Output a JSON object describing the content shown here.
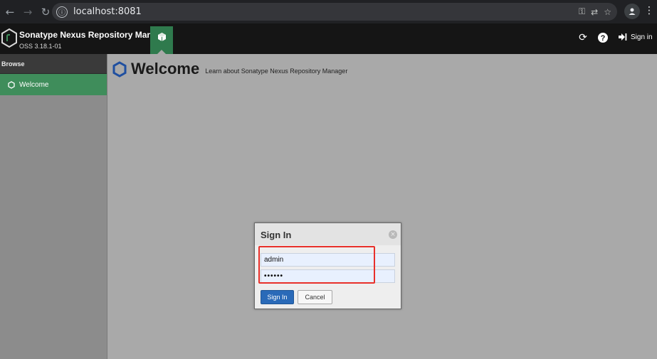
{
  "browser": {
    "url": "localhost:8081",
    "back_icon": "←",
    "forward_icon": "→",
    "reload_icon": "↻",
    "info_icon": "ⓘ",
    "key_icon": "⚿",
    "translate_icon": "⇄",
    "star_icon": "☆",
    "kebab_icon": "⋮"
  },
  "header": {
    "app_title": "Sonatype Nexus Repository Manager",
    "version": "OSS 3.18.1-01",
    "refresh_icon": "⟳",
    "help_icon": "?",
    "signin_label": "Sign in",
    "accent_color": "#2f7a4d"
  },
  "sidebar": {
    "header": "Browse",
    "items": [
      {
        "label": "Welcome",
        "selected": true
      }
    ]
  },
  "main": {
    "title": "Welcome",
    "subtitle": "Learn about Sonatype Nexus Repository Manager"
  },
  "dialog": {
    "title": "Sign In",
    "username_value": "admin",
    "password_value": "••••••",
    "signin_button": "Sign In",
    "cancel_button": "Cancel",
    "close_icon": "×",
    "highlight_color": "#e8302a"
  }
}
